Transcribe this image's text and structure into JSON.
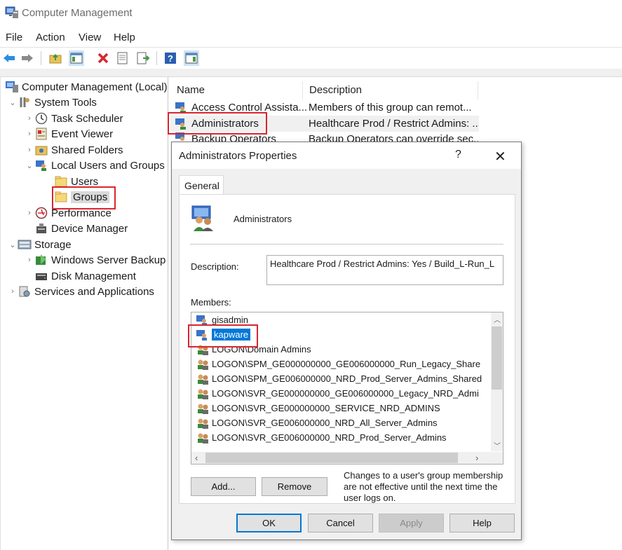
{
  "window": {
    "title": "Computer Management"
  },
  "menu": [
    "File",
    "Action",
    "View",
    "Help"
  ],
  "toolbar": [
    "back-icon",
    "forward-icon",
    "up-folder-icon",
    "show-hide-tree-icon",
    "delete-icon",
    "properties-icon",
    "export-list-icon",
    "help-icon",
    "action-pane-icon"
  ],
  "tree": {
    "root": "Computer Management (Local)",
    "system_tools": "System Tools",
    "task_scheduler": "Task Scheduler",
    "event_viewer": "Event Viewer",
    "shared_folders": "Shared Folders",
    "local_users_groups": "Local Users and Groups",
    "users": "Users",
    "groups": "Groups",
    "performance": "Performance",
    "device_manager": "Device Manager",
    "storage": "Storage",
    "wsb": "Windows Server Backup",
    "disk_management": "Disk Management",
    "services_apps": "Services and Applications"
  },
  "list": {
    "col_name": "Name",
    "col_desc": "Description",
    "rows": [
      {
        "name": "Access Control Assista...",
        "desc": "Members of this group can remot..."
      },
      {
        "name": "Administrators",
        "desc": "Healthcare Prod / Restrict Admins: ..."
      },
      {
        "name": "Backup Operators",
        "desc": "Backup Operators can override sec..."
      }
    ]
  },
  "dialog": {
    "title": "Administrators Properties",
    "help_glyph": "?",
    "close_glyph": "✕",
    "tab": "General",
    "group_name": "Administrators",
    "description_label": "Description:",
    "description_value": "Healthcare Prod / Restrict Admins: Yes / Build_L-Run_L",
    "members_label": "Members:",
    "members": [
      "gisadmin",
      "kapware",
      "LOGON\\Domain Admins",
      "LOGON\\SPM_GE000000000_GE006000000_Run_Legacy_Share",
      "LOGON\\SPM_GE006000000_NRD_Prod_Server_Admins_Shared",
      "LOGON\\SVR_GE000000000_GE006000000_Legacy_NRD_Admi",
      "LOGON\\SVR_GE000000000_SERVICE_NRD_ADMINS",
      "LOGON\\SVR_GE006000000_NRD_All_Server_Admins",
      "LOGON\\SVR_GE006000000_NRD_Prod_Server_Admins"
    ],
    "add": "Add...",
    "remove": "Remove",
    "note": "Changes to a user's group membership are not effective until the next time the user logs on.",
    "ok": "OK",
    "cancel": "Cancel",
    "apply": "Apply",
    "help": "Help"
  }
}
